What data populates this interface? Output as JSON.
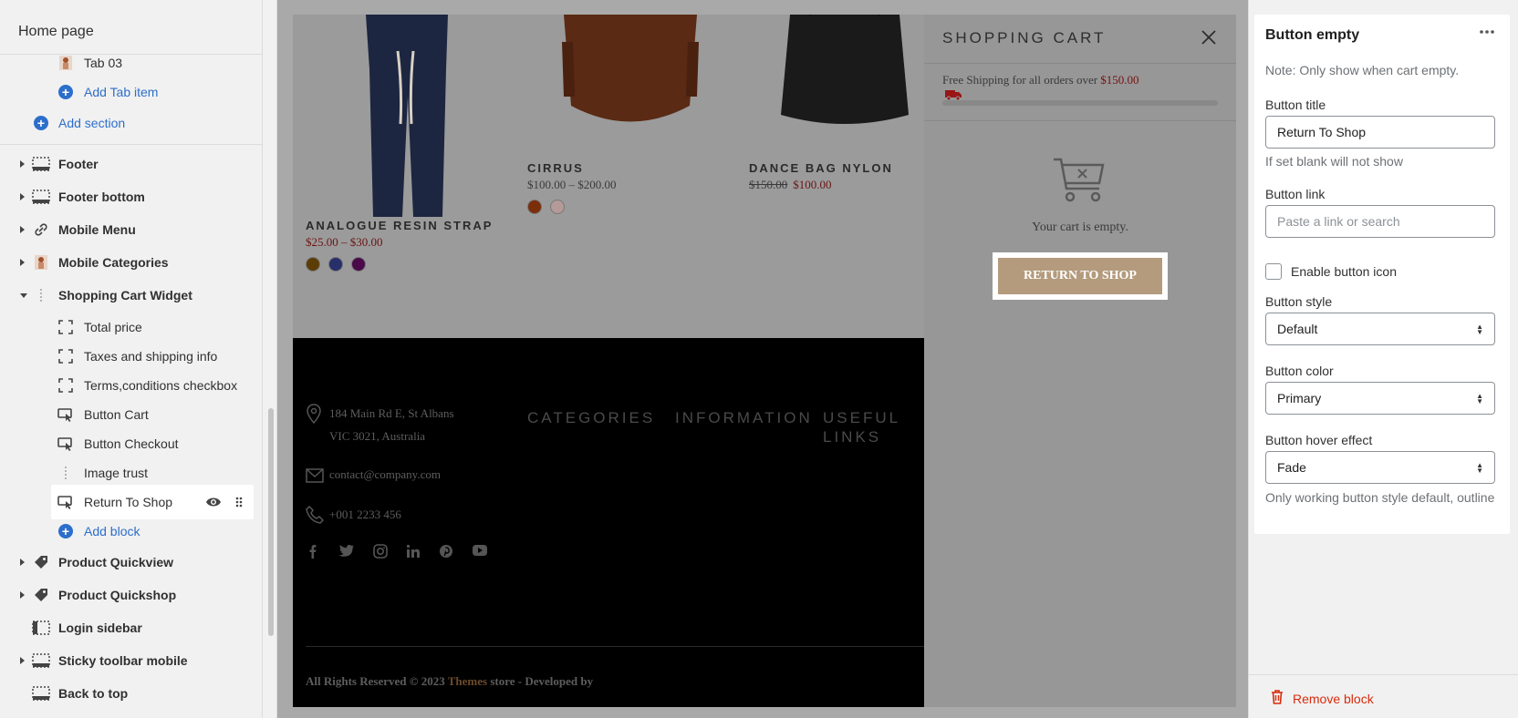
{
  "sidebar": {
    "title": "Home page",
    "items": [
      {
        "label": "Tab 03"
      },
      {
        "label": "Add Tab item"
      },
      {
        "label": "Add section"
      },
      {
        "label": "Footer"
      },
      {
        "label": "Footer bottom"
      },
      {
        "label": "Mobile Menu"
      },
      {
        "label": "Mobile Categories"
      },
      {
        "label": "Shopping Cart Widget"
      },
      {
        "label": "Total price"
      },
      {
        "label": "Taxes and shipping info"
      },
      {
        "label": "Terms,conditions checkbox"
      },
      {
        "label": "Button Cart"
      },
      {
        "label": "Button Checkout"
      },
      {
        "label": "Image trust"
      },
      {
        "label": "Return To Shop"
      },
      {
        "label": "Add block"
      },
      {
        "label": "Product Quickview"
      },
      {
        "label": "Product Quickshop"
      },
      {
        "label": "Login sidebar"
      },
      {
        "label": "Sticky toolbar mobile"
      },
      {
        "label": "Back to top"
      }
    ]
  },
  "preview": {
    "products": [
      {
        "name": "ANALOGUE RESIN STRAP",
        "price": "$25.00 – $30.00",
        "swatches": [
          "#5c3d06",
          "#27306b",
          "#4a0a4a"
        ]
      },
      {
        "name": "CIRRUS",
        "price": "$100.00 – $200.00",
        "swatches": [
          "#7a2e0a",
          "#b59a9a"
        ]
      },
      {
        "name": "DANCE BAG NYLON",
        "old_price": "$150.00",
        "new_price": "$100.00"
      }
    ],
    "footer": {
      "address_line1": "184 Main Rd E, St Albans",
      "address_line2": "VIC 3021, Australia",
      "email": "contact@company.com",
      "phone": "+001 2233 456",
      "col1": "CATEGORIES",
      "col2": "INFORMATION",
      "col3_line1": "USEFUL",
      "col3_line2": "LINKS",
      "copy_prefix": "All Rights Reserved © 2023 ",
      "copy_brand": "Themes",
      "copy_suffix": " store - Developed by"
    },
    "cart": {
      "title": "SHOPPING CART",
      "shipping_prefix": "Free Shipping for all orders over ",
      "shipping_amount": "$150.00",
      "empty_text": "Your cart is empty.",
      "button_label": "RETURN TO SHOP"
    }
  },
  "panel": {
    "title": "Button empty",
    "note": "Note: Only show when cart empty.",
    "button_title_label": "Button title",
    "button_title_value": "Return To Shop",
    "button_title_help": "If set blank will not show",
    "button_link_label": "Button link",
    "button_link_placeholder": "Paste a link or search",
    "enable_icon_label": "Enable button icon",
    "button_style_label": "Button style",
    "button_style_value": "Default",
    "button_color_label": "Button color",
    "button_color_value": "Primary",
    "hover_label": "Button hover effect",
    "hover_value": "Fade",
    "hover_help": "Only working button style default, outline",
    "remove_label": "Remove block"
  },
  "colors": {
    "accent": "#2c6ecb",
    "danger": "#d72c0d",
    "cart_button": "#b49b7d"
  }
}
